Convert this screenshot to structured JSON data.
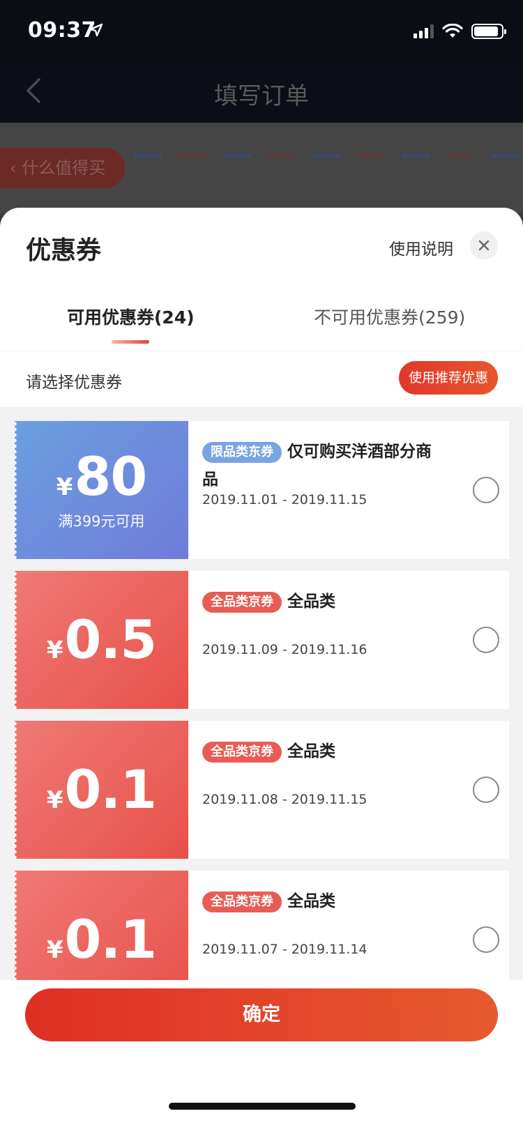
{
  "status_bar": {
    "time": "09:37"
  },
  "nav": {
    "title": "填写订单"
  },
  "background": {
    "pill_label": "什么值得买"
  },
  "sheet": {
    "title": "优惠券",
    "usage_link": "使用说明",
    "tabs": [
      {
        "label": "可用优惠券(24)",
        "active": true
      },
      {
        "label": "不可用优惠券(259)",
        "active": false
      }
    ],
    "select_label": "请选择优惠券",
    "recommend_button": "使用推荐优惠"
  },
  "coupons": [
    {
      "currency": "¥",
      "value": "80",
      "condition": "满399元可用",
      "tag": "限品类东券",
      "desc": "仅可购买洋酒部分商品",
      "date": "2019.11.01 - 2019.11.15",
      "color": "blue"
    },
    {
      "currency": "¥",
      "value": "0.5",
      "condition": "",
      "tag": "全品类京券",
      "desc": "全品类",
      "date": "2019.11.09 - 2019.11.16",
      "color": "red"
    },
    {
      "currency": "¥",
      "value": "0.1",
      "condition": "",
      "tag": "全品类京券",
      "desc": "全品类",
      "date": "2019.11.08 - 2019.11.15",
      "color": "red"
    },
    {
      "currency": "¥",
      "value": "0.1",
      "condition": "",
      "tag": "全品类京券",
      "desc": "全品类",
      "date": "2019.11.07 - 2019.11.14",
      "color": "red"
    }
  ],
  "footer": {
    "confirm_button": "确定"
  },
  "colors": {
    "accent": "#e2362a",
    "blue_coupon": "#6c9fe0",
    "red_coupon": "#e8504a"
  }
}
